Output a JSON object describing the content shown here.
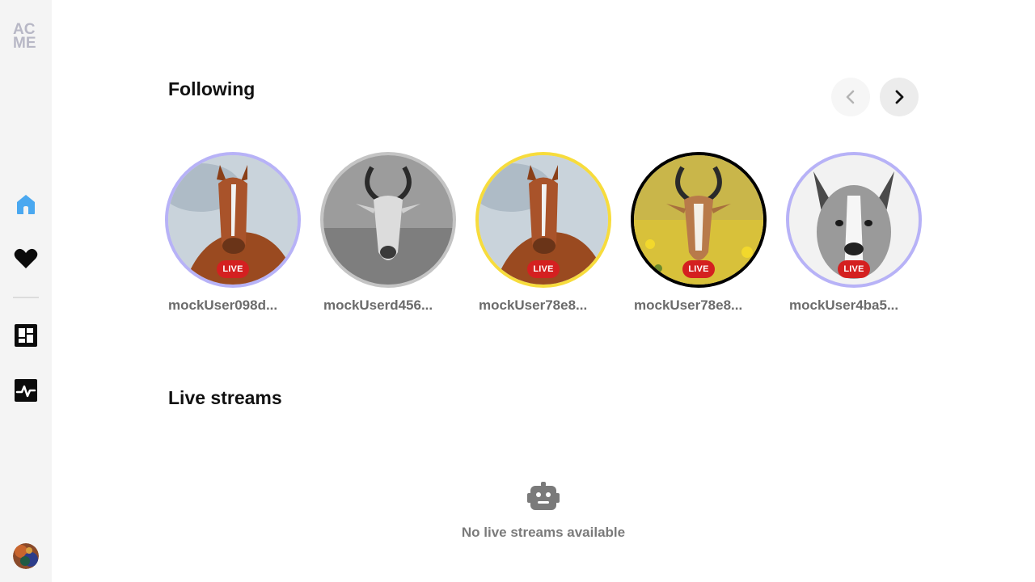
{
  "sidebar": {
    "logo_line1": "AC",
    "logo_line2": "ME",
    "nav": [
      {
        "icon": "home-icon",
        "active_color": "#4aa8f0"
      },
      {
        "icon": "heart-icon"
      },
      {
        "icon": "dashboard-icon"
      },
      {
        "icon": "activity-icon"
      }
    ],
    "avatar": "user-avatar"
  },
  "following": {
    "title": "Following",
    "prev_icon": "chevron-left-icon",
    "next_icon": "chevron-right-icon",
    "users": [
      {
        "name": "mockUser098d...",
        "live": "LIVE",
        "image": "horse",
        "ring_color": "#b7b2f7"
      },
      {
        "name": "mockUserd456...",
        "live": "",
        "image": "antelope-grayscale",
        "ring_color": "#c4c4c4"
      },
      {
        "name": "mockUser78e8...",
        "live": "LIVE",
        "image": "horse",
        "ring_color": "#f7dc3c"
      },
      {
        "name": "mockUser78e8...",
        "live": "LIVE",
        "image": "antelope-flowers",
        "ring_color": "#000000"
      },
      {
        "name": "mockUser4ba5...",
        "live": "LIVE",
        "image": "dog-grayscale",
        "ring_color": "#b7b2f7"
      }
    ]
  },
  "live_streams": {
    "title": "Live streams",
    "empty_icon": "robot-icon",
    "empty_text": "No live streams available"
  },
  "colors": {
    "live_badge": "#d42020",
    "sidebar_bg": "#f4f4f4"
  }
}
